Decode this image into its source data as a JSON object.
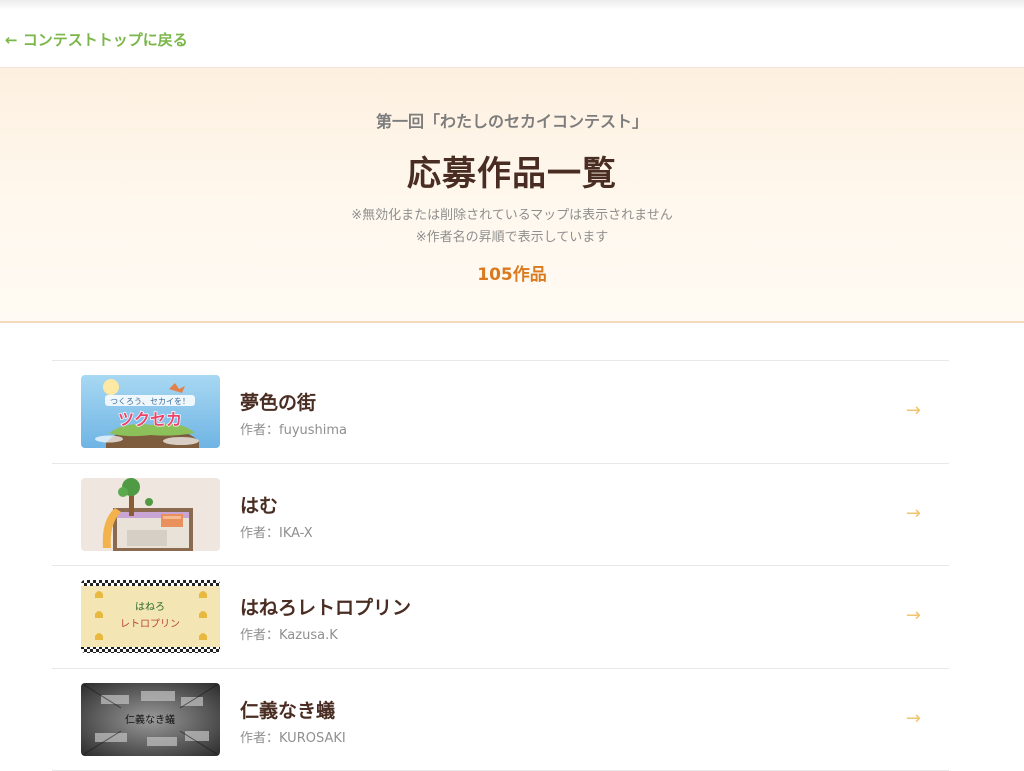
{
  "nav": {
    "back_label": "← コンテストトップに戻る"
  },
  "hero": {
    "contest_name": "第一回「わたしのセカイコンテスト」",
    "title": "応募作品一覧",
    "note_1": "※無効化または削除されているマップは表示されません",
    "note_2": "※作者名の昇順で表示しています",
    "count": "105作品"
  },
  "colors": {
    "accent_green": "#7ab648",
    "count_orange": "#d97a1e",
    "title_brown": "#4a2d22",
    "arrow_gold": "#f2c46b"
  },
  "works": [
    {
      "title": "夢色の街",
      "author": "作者：fuyushima",
      "thumb_text_1": "つくろう、セカイを！",
      "thumb_text_2": "ツクセカ",
      "arrow": "→"
    },
    {
      "title": "はむ",
      "author": "作者：IKA-X",
      "arrow": "→"
    },
    {
      "title": "はねろレトロプリン",
      "author": "作者：Kazusa.K",
      "thumb_text_1": "はねろ",
      "thumb_text_2": "レトロプリン",
      "arrow": "→"
    },
    {
      "title": "仁義なき蟻",
      "author": "作者：KUROSAKI",
      "thumb_text_1": "仁義なき蟻",
      "arrow": "→"
    }
  ]
}
